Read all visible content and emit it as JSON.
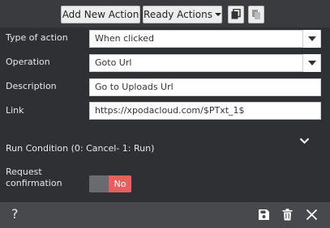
{
  "toolbar": {
    "add_label": "Add New Action",
    "ready_label": "Ready Actions",
    "copy_icon": "copy-icon",
    "paste_icon": "paste-icon"
  },
  "form": {
    "type_label": "Type of action",
    "type_value": "When clicked",
    "operation_label": "Operation",
    "operation_value": "Goto Url",
    "description_label": "Description",
    "description_value": "Go to Uploads Url",
    "link_label": "Link",
    "link_value": "https://xpodacloud.com/$PTxt_1$"
  },
  "run_condition": {
    "title": "Run Condition (0: Cancel- 1: Run)",
    "expand_icon": "chevron-down-icon"
  },
  "request": {
    "label_line1": "Request",
    "label_line2": "confirmation",
    "toggle_value": "No",
    "toggle_color": "#e85f5f"
  },
  "footer": {
    "help": "?",
    "save_icon": "save-icon",
    "delete_icon": "trash-icon",
    "close_icon": "close-icon"
  }
}
